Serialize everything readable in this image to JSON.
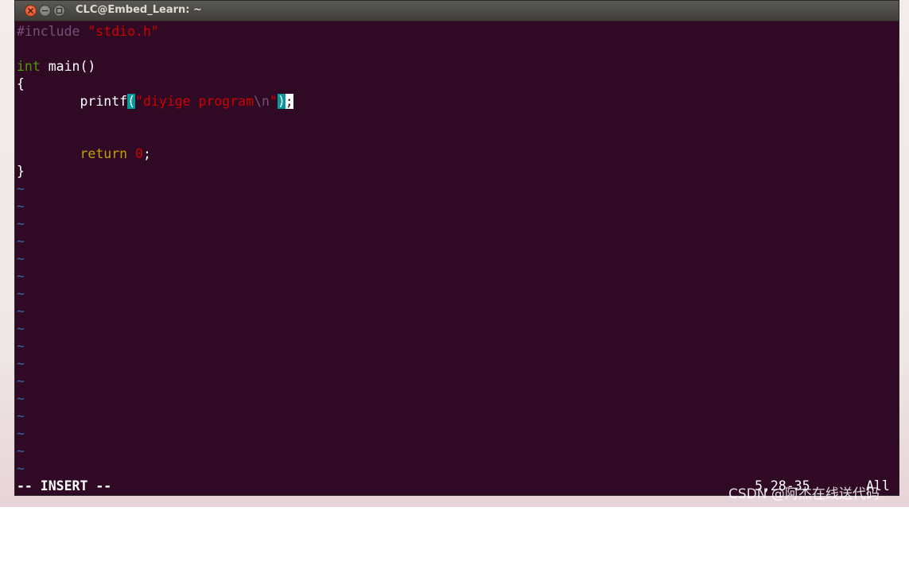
{
  "window": {
    "title": "CLC@Embed_Learn: ~"
  },
  "editor": {
    "lines": {
      "l1_pre": "#include ",
      "l1_str": "\"stdio.h\"",
      "l2": "",
      "l3_type": "int",
      "l3_rest": " main()",
      "l4": "{",
      "l5_indent": "        printf",
      "l5_paren_open": "(",
      "l5_str_a": "\"diyige program",
      "l5_esc": "\\n",
      "l5_str_b": "\"",
      "l5_paren_close": ")",
      "l5_semicolon": ";",
      "l6": "",
      "l7": "",
      "l8_indent": "        ",
      "l8_kw": "return",
      "l8_sp": " ",
      "l8_num": "0",
      "l8_semi": ";",
      "l9": "}"
    },
    "tilde": "~",
    "tilde_count": 17
  },
  "status": {
    "mode": "-- INSERT --",
    "position": "5,28-35",
    "scroll": "All"
  },
  "watermark": "CSDN @阿杰在线送代码",
  "colors": {
    "background": "#300a24",
    "preprocessor": "#75507b",
    "string": "#cc0000",
    "type": "#4e9a06",
    "keyword": "#c4a000",
    "tilde": "#3465a4",
    "match_highlight": "#06989a"
  }
}
